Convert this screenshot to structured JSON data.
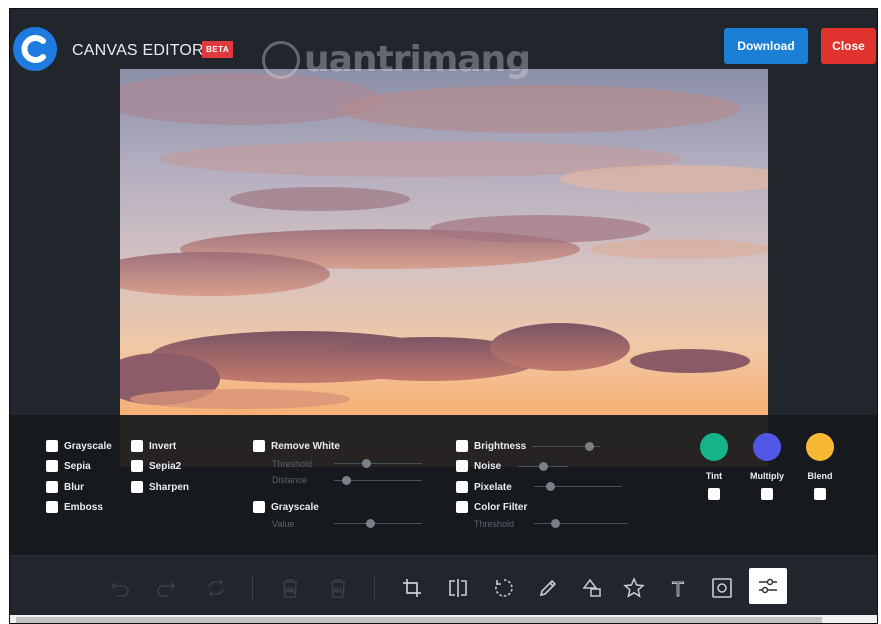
{
  "header": {
    "app_title": "CANVAS EDITOR",
    "badge": "BETA",
    "download_label": "Download",
    "close_label": "Close"
  },
  "watermark": {
    "text": "uantrimang"
  },
  "filters": {
    "col1": [
      "Grayscale",
      "Sepia",
      "Blur",
      "Emboss"
    ],
    "col2": [
      "Invert",
      "Sepia2",
      "Sharpen"
    ],
    "remove_white": {
      "label": "Remove White",
      "threshold_label": "Threshold",
      "distance_label": "Distance"
    },
    "grayscale2": {
      "label": "Grayscale",
      "value_label": "Value"
    },
    "col4": {
      "brightness": "Brightness",
      "noise": "Noise",
      "pixelate": "Pixelate",
      "color_filter": "Color Filter",
      "threshold_label": "Threshold"
    },
    "sliders": {
      "threshold": 0.35,
      "distance": 0.1,
      "value": 0.4,
      "brightness": 0.9,
      "noise": 0.5,
      "pixelate": 0.15,
      "color_filter_threshold": 0.2
    }
  },
  "blend": [
    {
      "label": "Tint",
      "color": "#14b38a"
    },
    {
      "label": "Multiply",
      "color": "#5158e8"
    },
    {
      "label": "Blend",
      "color": "#f7b834"
    }
  ],
  "toolbar": {
    "tools": [
      "undo-icon",
      "redo-icon",
      "repeat-icon",
      "delete-icon",
      "delete-all-icon",
      "crop-icon",
      "flip-icon",
      "rotate-icon",
      "draw-icon",
      "shape-icon",
      "star-icon",
      "text-icon",
      "mask-icon",
      "filter-icon"
    ],
    "delete_glyph": "DEL",
    "delete_all_glyph": "ALL",
    "text_glyph": "T"
  },
  "colors": {
    "accent": "#1c7fd6",
    "danger": "#e0332f",
    "background": "#21262d"
  }
}
